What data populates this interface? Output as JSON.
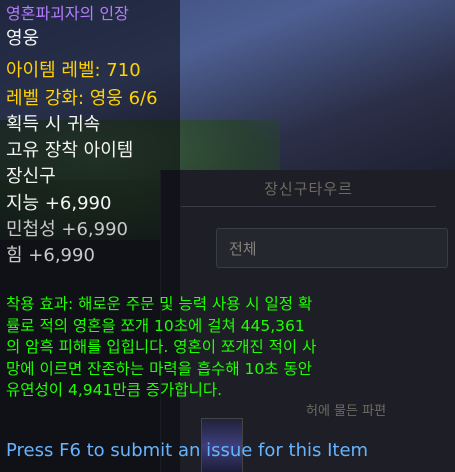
{
  "background": {
    "panel_title": "장신구타우르",
    "filter_dropdown": "전체",
    "list_item_text": "허에 물든 파편"
  },
  "tooltip": {
    "item_name": "영혼파괴자의 인장",
    "quality": "영웅",
    "item_level": "아이템 레벨: 710",
    "upgrade": "레벨 강화: 영웅 6/6",
    "binding": "획득 시 귀속",
    "unique": "고유 장착 아이템",
    "slot": "장신구",
    "stat_int": "지능 +6,990",
    "stat_agi": "민첩성 +6,990",
    "stat_str": "힘 +6,990",
    "equip_effect": "착용 효과: 해로운 주문 및 능력 사용 시 일정 확\n률로 적의 영혼을 쪼개 10초에 걸쳐 445,361\n의 암흑 피해를 입힙니다. 영혼이 쪼개진 적이 사\n망에 이르면 잔존하는 마력을 흡수해 10초 동안\n유연성이 4,941만큼 증가합니다.",
    "press_hint": "Press F6 to submit an issue for this Item"
  },
  "colors": {
    "epic": "#b27cff",
    "yellow": "#ffd200",
    "green": "#1eff00",
    "hint": "#66b4ff"
  }
}
